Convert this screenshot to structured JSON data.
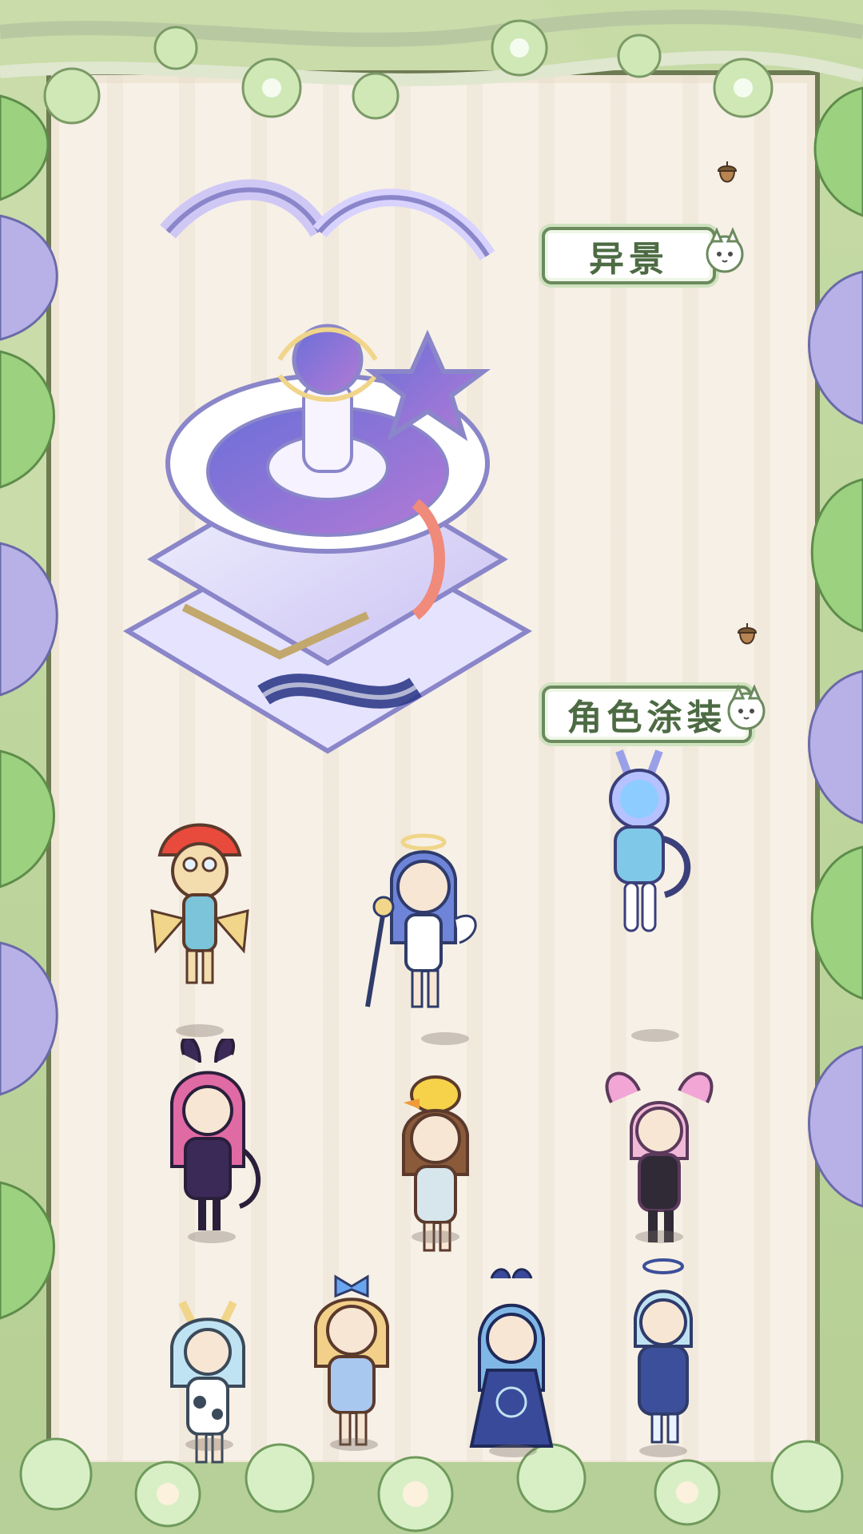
{
  "scene": {
    "background_color": "#f7f0e6",
    "frame_color": "#6d7a52",
    "accent_color": "#6b8a5e"
  },
  "labels": {
    "yijing": "异景",
    "juese_tuzhuang": "角色涂装"
  },
  "icons": {
    "acorn": "acorn-icon",
    "cat": "cat-icon"
  },
  "characters": [
    {
      "name": "red-hat-goggles-fairy",
      "hair": "#f3dcae",
      "outfit": "#e84a3b"
    },
    {
      "name": "blue-haired-angel-staff",
      "hair": "#6d84d8",
      "outfit": "#ffffff"
    },
    {
      "name": "astronaut-bunny-robot",
      "hair": "#c9c6f2",
      "outfit": "#7fc8e8"
    },
    {
      "name": "pink-haired-bunny-witch",
      "hair": "#e06aa4",
      "outfit": "#3b2a58"
    },
    {
      "name": "duck-hat-girl",
      "hair": "#8a5a3a",
      "outfit": "#d7e6ec"
    },
    {
      "name": "pink-twin-tails-girl",
      "hair": "#f2b8d8",
      "outfit": "#2f2a36"
    },
    {
      "name": "cow-horn-girl",
      "hair": "#bfe3f2",
      "outfit": "#ffffff"
    },
    {
      "name": "blonde-bow-girl",
      "hair": "#f2d08a",
      "outfit": "#a9c8f0"
    },
    {
      "name": "crab-crown-girl",
      "hair": "#7fb8e6",
      "outfit": "#3a4a9a"
    },
    {
      "name": "halo-boy",
      "hair": "#bfe2f2",
      "outfit": "#3c4f9a"
    }
  ]
}
